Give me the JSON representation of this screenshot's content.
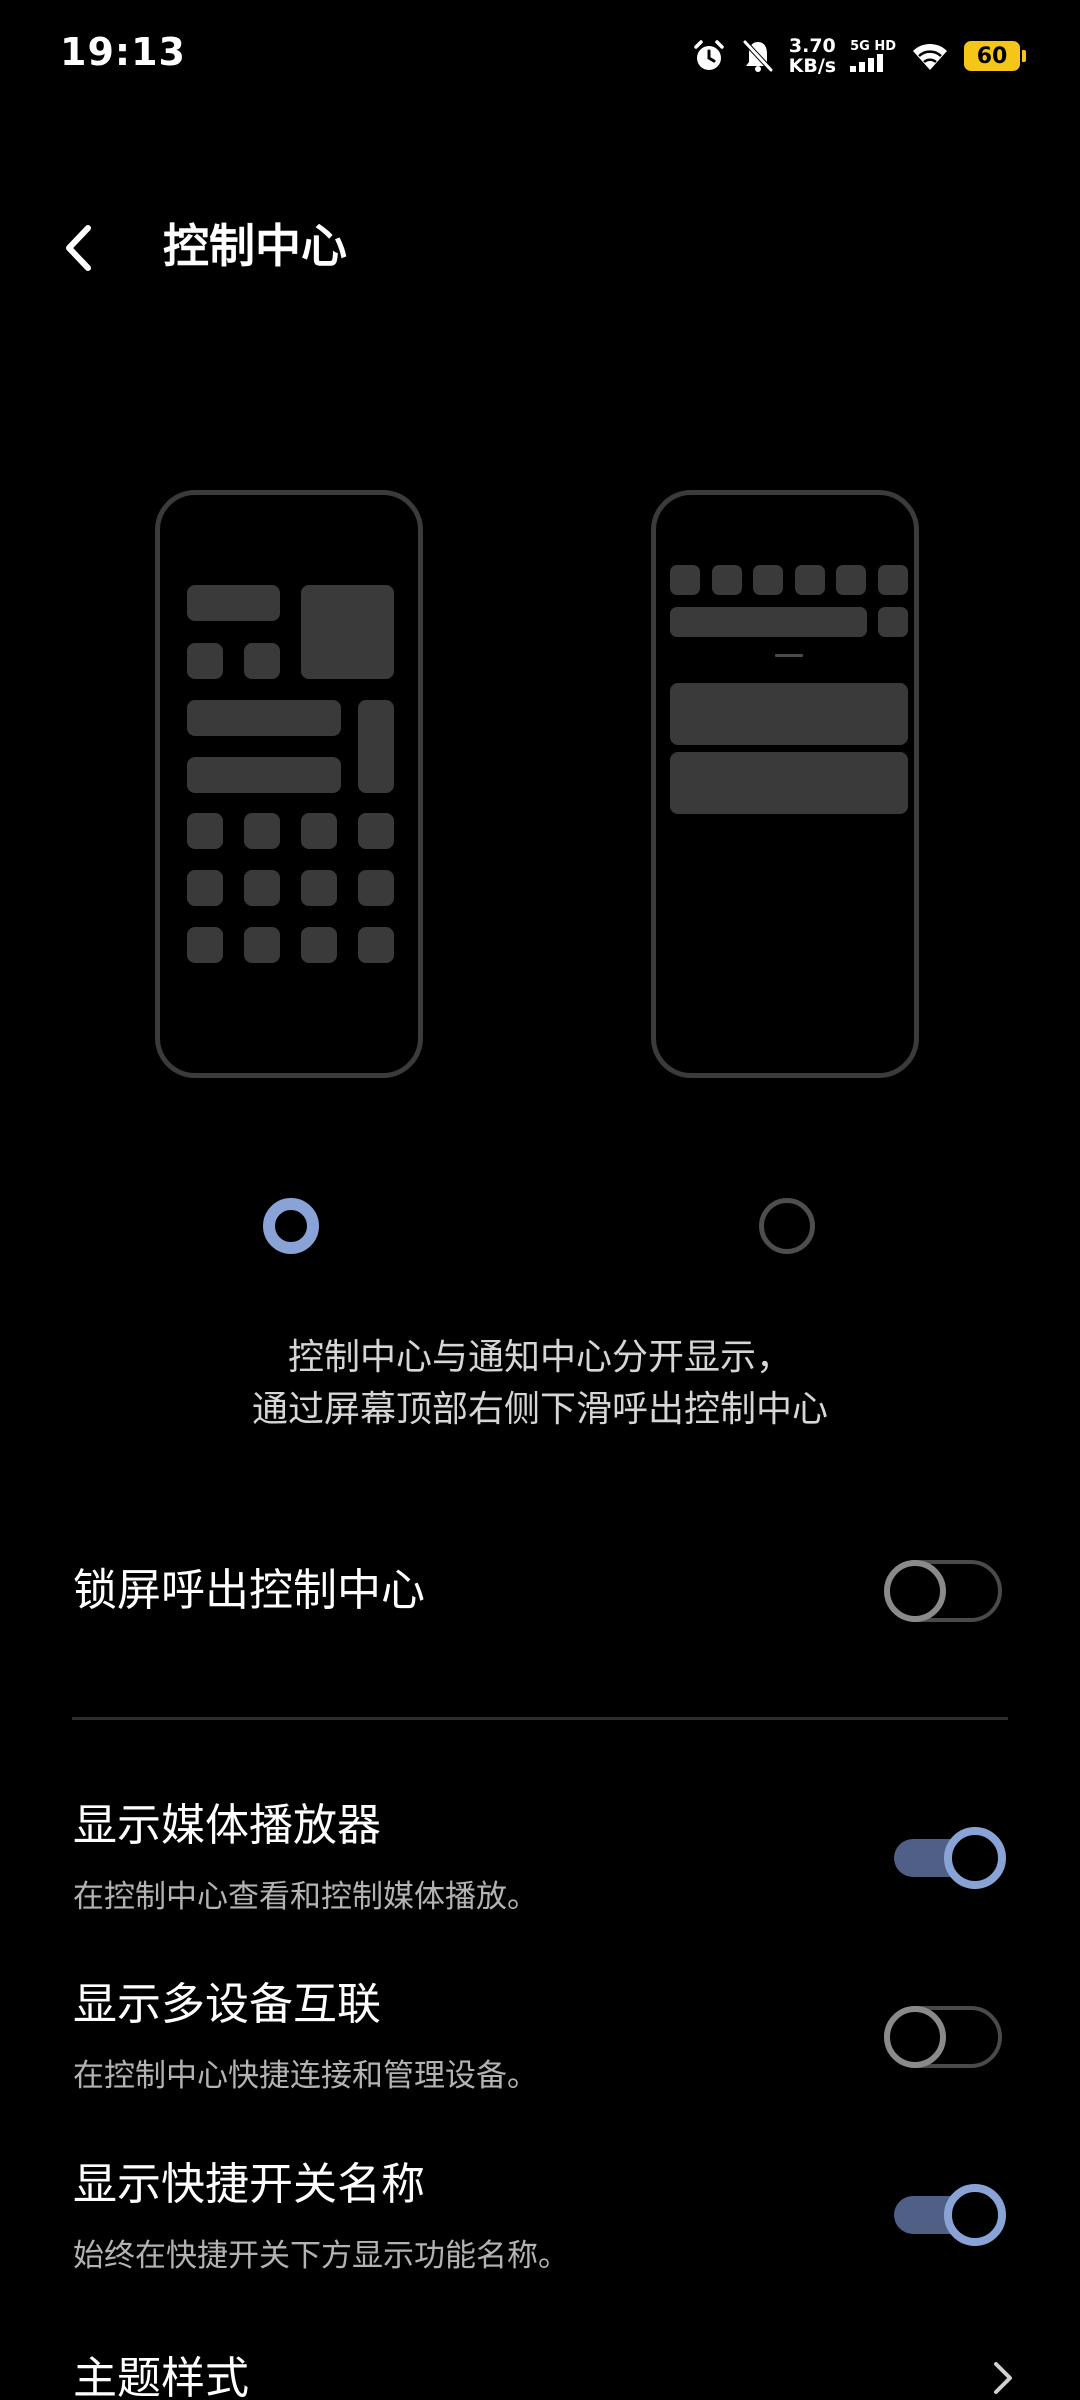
{
  "status_bar": {
    "time": "19:13",
    "net_speed_value": "3.70",
    "net_speed_unit": "KB/s",
    "signal_label": "5G HD",
    "battery": "60"
  },
  "header": {
    "title": "控制中心"
  },
  "layout_options": {
    "selected": "left",
    "description_line1": "控制中心与通知中心分开显示，",
    "description_line2": "通过屏幕顶部右侧下滑呼出控制中心"
  },
  "settings": {
    "lock_screen": {
      "title": "锁屏呼出控制中心",
      "enabled": false
    },
    "media_player": {
      "title": "显示媒体播放器",
      "subtitle": "在控制中心查看和控制媒体播放。",
      "enabled": true
    },
    "multi_device": {
      "title": "显示多设备互联",
      "subtitle": "在控制中心快捷连接和管理设备。",
      "enabled": false
    },
    "toggle_names": {
      "title": "显示快捷开关名称",
      "subtitle": "始终在快捷开关下方显示功能名称。",
      "enabled": true
    },
    "theme_style": {
      "title": "主题样式"
    }
  },
  "colors": {
    "accent": "#8aa3d6",
    "toggle_on_track": "#4f5f86",
    "battery": "#f5c518",
    "background": "#000000"
  }
}
